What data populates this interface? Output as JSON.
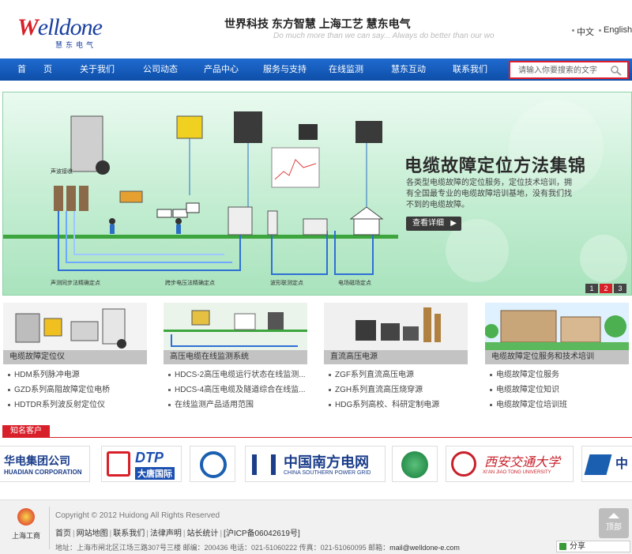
{
  "header": {
    "logo_text_w": "W",
    "logo_text_rest": "elldone",
    "logo_sub": "慧东电气",
    "slogan": "世界科技 东方智慧 上海工艺 慧东电气",
    "slogan_en": "Do much more than we can say...   Always do better than our wo",
    "lang_cn": "中文",
    "lang_en": "English"
  },
  "nav": {
    "items": [
      "首　　页",
      "关于我们",
      "公司动态",
      "产品中心",
      "服务与支持",
      "在线监测",
      "慧东互动",
      "联系我们"
    ],
    "search_placeholder": "请输入你要搜索的文字"
  },
  "banner": {
    "title": "电缆故障定位方法集锦",
    "desc": "各类型电缆故障的定位服务，定位技术培训，拥有全国最专业的电缆故障培训基地，没有我们找不到的电缆故障。",
    "button": "查看详细",
    "dots": [
      "1",
      "2",
      "3"
    ],
    "active_dot": 1,
    "diagram_labels": [
      "声测同步法精确定点",
      "跨步电压法精确定点",
      "波形联测定点",
      "电场磁场定点",
      "声波接收"
    ]
  },
  "products": [
    {
      "title": "电缆故障定位仪",
      "items": [
        "HDM系列脉冲电源",
        "GZD系列高阻故障定位电桥",
        "HDTDR系列波反射定位仪"
      ]
    },
    {
      "title": "高压电缆在线监测系统",
      "items": [
        "HDCS-2高压电缆运行状态在线监测...",
        "HDCS-4高压电缆及隧道综合在线监...",
        "在线监测产品适用范围"
      ]
    },
    {
      "title": "直流高压电源",
      "items": [
        "ZGF系列直流高压电源",
        "ZGH系列直流高压烧穿源",
        "HDG系列高校、科研定制电源"
      ]
    },
    {
      "title": "电缆故障定位服务和技术培训",
      "items": [
        "电缆故障定位服务",
        "电缆故障定位知识",
        "电缆故障定位培训班"
      ]
    }
  ],
  "clients": {
    "title": "知名客户",
    "logos": [
      {
        "cn": "华电集团公司",
        "en": "HUADIAN CORPORATION"
      },
      {
        "cn": "DTP",
        "en": "大唐国际"
      },
      {
        "cn": "",
        "en": ""
      },
      {
        "cn": "中国南方电网",
        "en": "CHINA SOUTHERN POWER GRID"
      },
      {
        "cn": "",
        "en": ""
      },
      {
        "cn": "西安交通大学",
        "en": "XI'AN JIAO TONG UNIVERSITY"
      },
      {
        "cn": "中",
        "en": ""
      }
    ]
  },
  "footer": {
    "badge": "上海工商",
    "copyright": "Copyright © 2012 Huidong All Rights Reserved",
    "links": [
      "首页",
      "网站地图",
      "联系我们",
      "法律声明",
      "站长统计",
      "[沪ICP备06042619号]"
    ],
    "address": "地址：上海市闸北区江场三路307号三楼 邮编：200436 电话：021-51060222 传真：021-51060095 邮箱：",
    "email": "mail@welldone-e.com",
    "top": "顶部",
    "share": "分享"
  },
  "colors": {
    "nav": "#1563c4",
    "accent": "#d8202a",
    "banner": "#bfead0"
  }
}
